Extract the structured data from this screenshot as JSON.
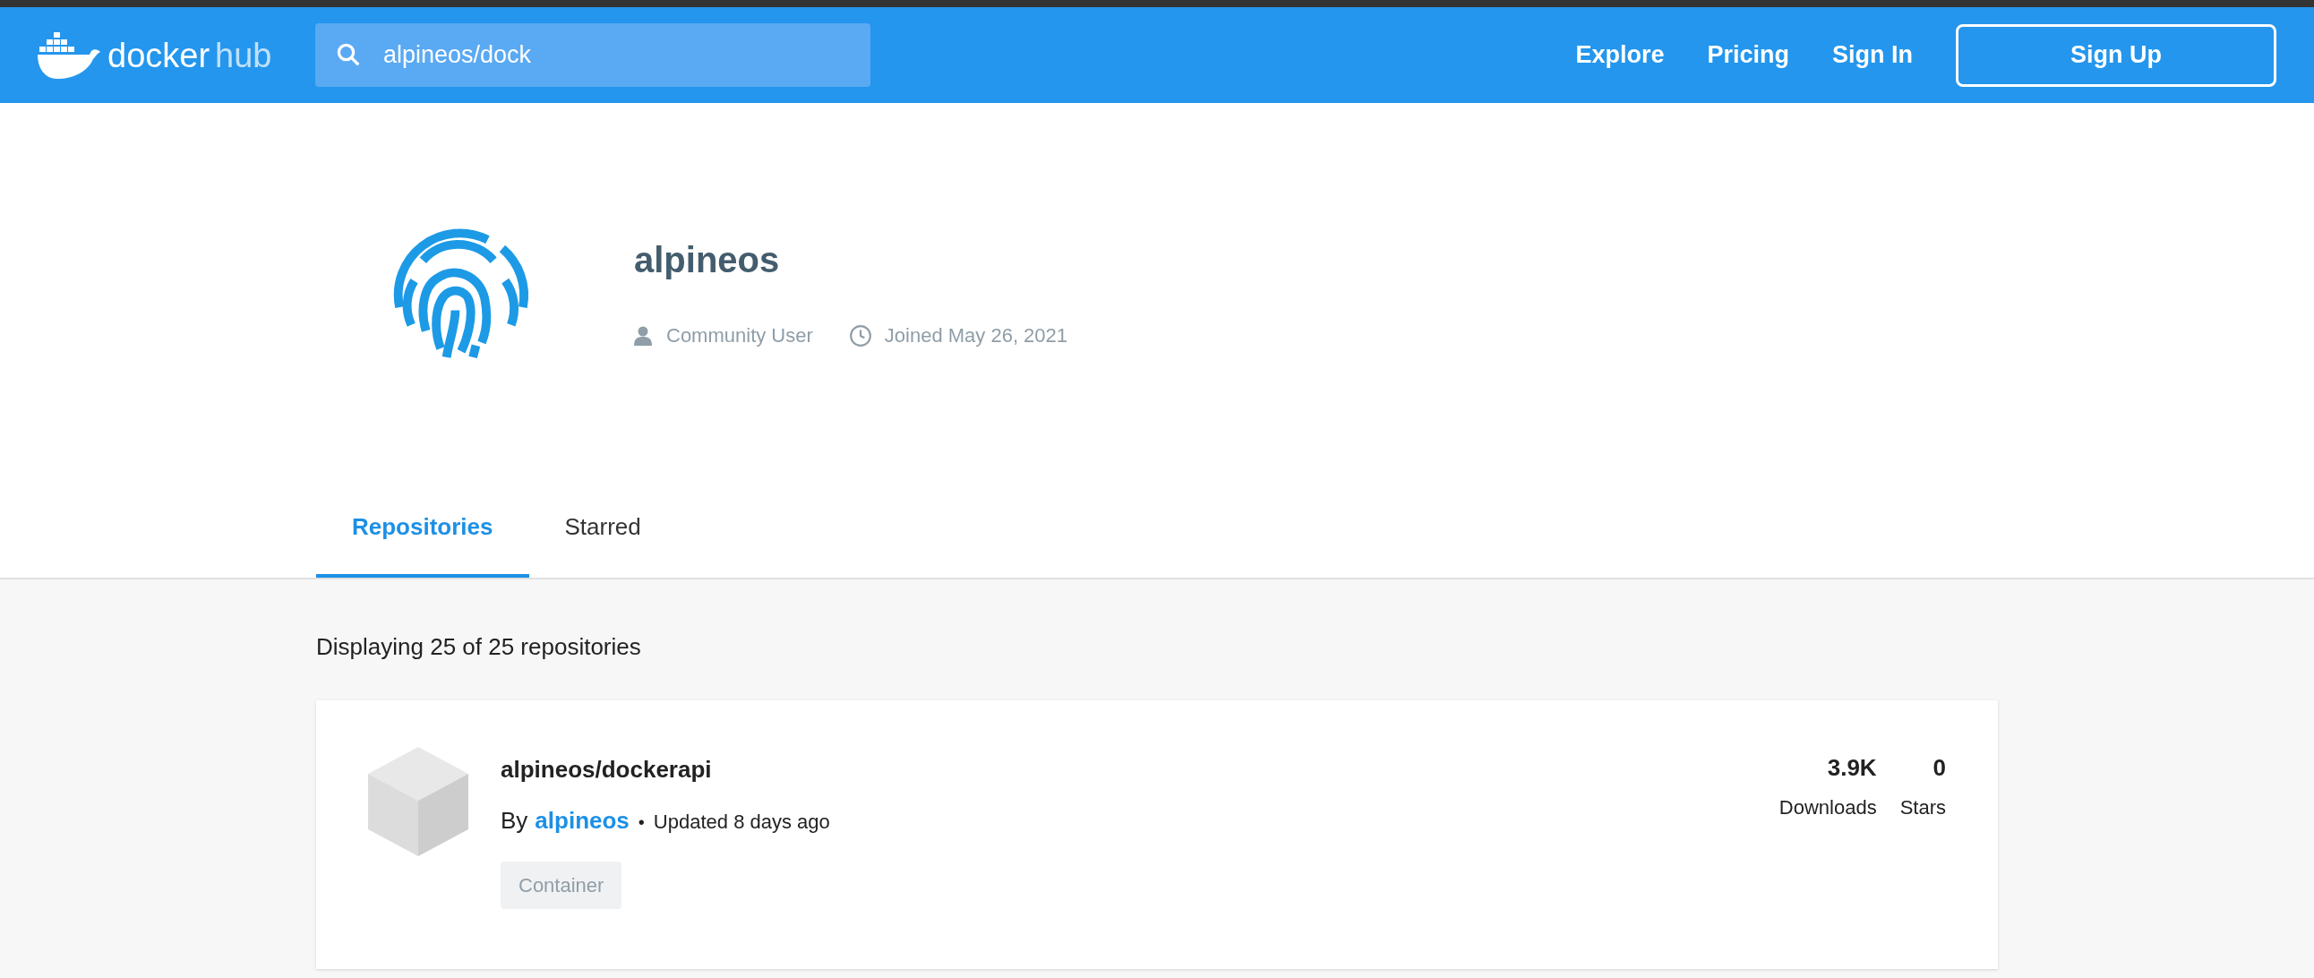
{
  "header": {
    "logo": {
      "word_1": "docker",
      "word_2": "hub"
    },
    "search": {
      "value": "alpineos/dock"
    },
    "nav": [
      "Explore",
      "Pricing",
      "Sign In"
    ],
    "signup_button": "Sign Up"
  },
  "profile": {
    "name": "alpineos",
    "role": "Community User",
    "joined": "Joined May 26, 2021"
  },
  "tabs": [
    {
      "label": "Repositories",
      "selected": true
    },
    {
      "label": "Starred",
      "selected": false
    }
  ],
  "summary": "Displaying 25 of 25 repositories",
  "repositories": [
    {
      "name": "alpineos/dockerapi",
      "by_label": "By",
      "owner": "alpineos",
      "separator": "•",
      "updated": "Updated 8 days ago",
      "tag": "Container",
      "downloads": "3.9K",
      "downloads_label": "Downloads",
      "stars_count": "0",
      "stars_label": "Stars"
    }
  ]
}
